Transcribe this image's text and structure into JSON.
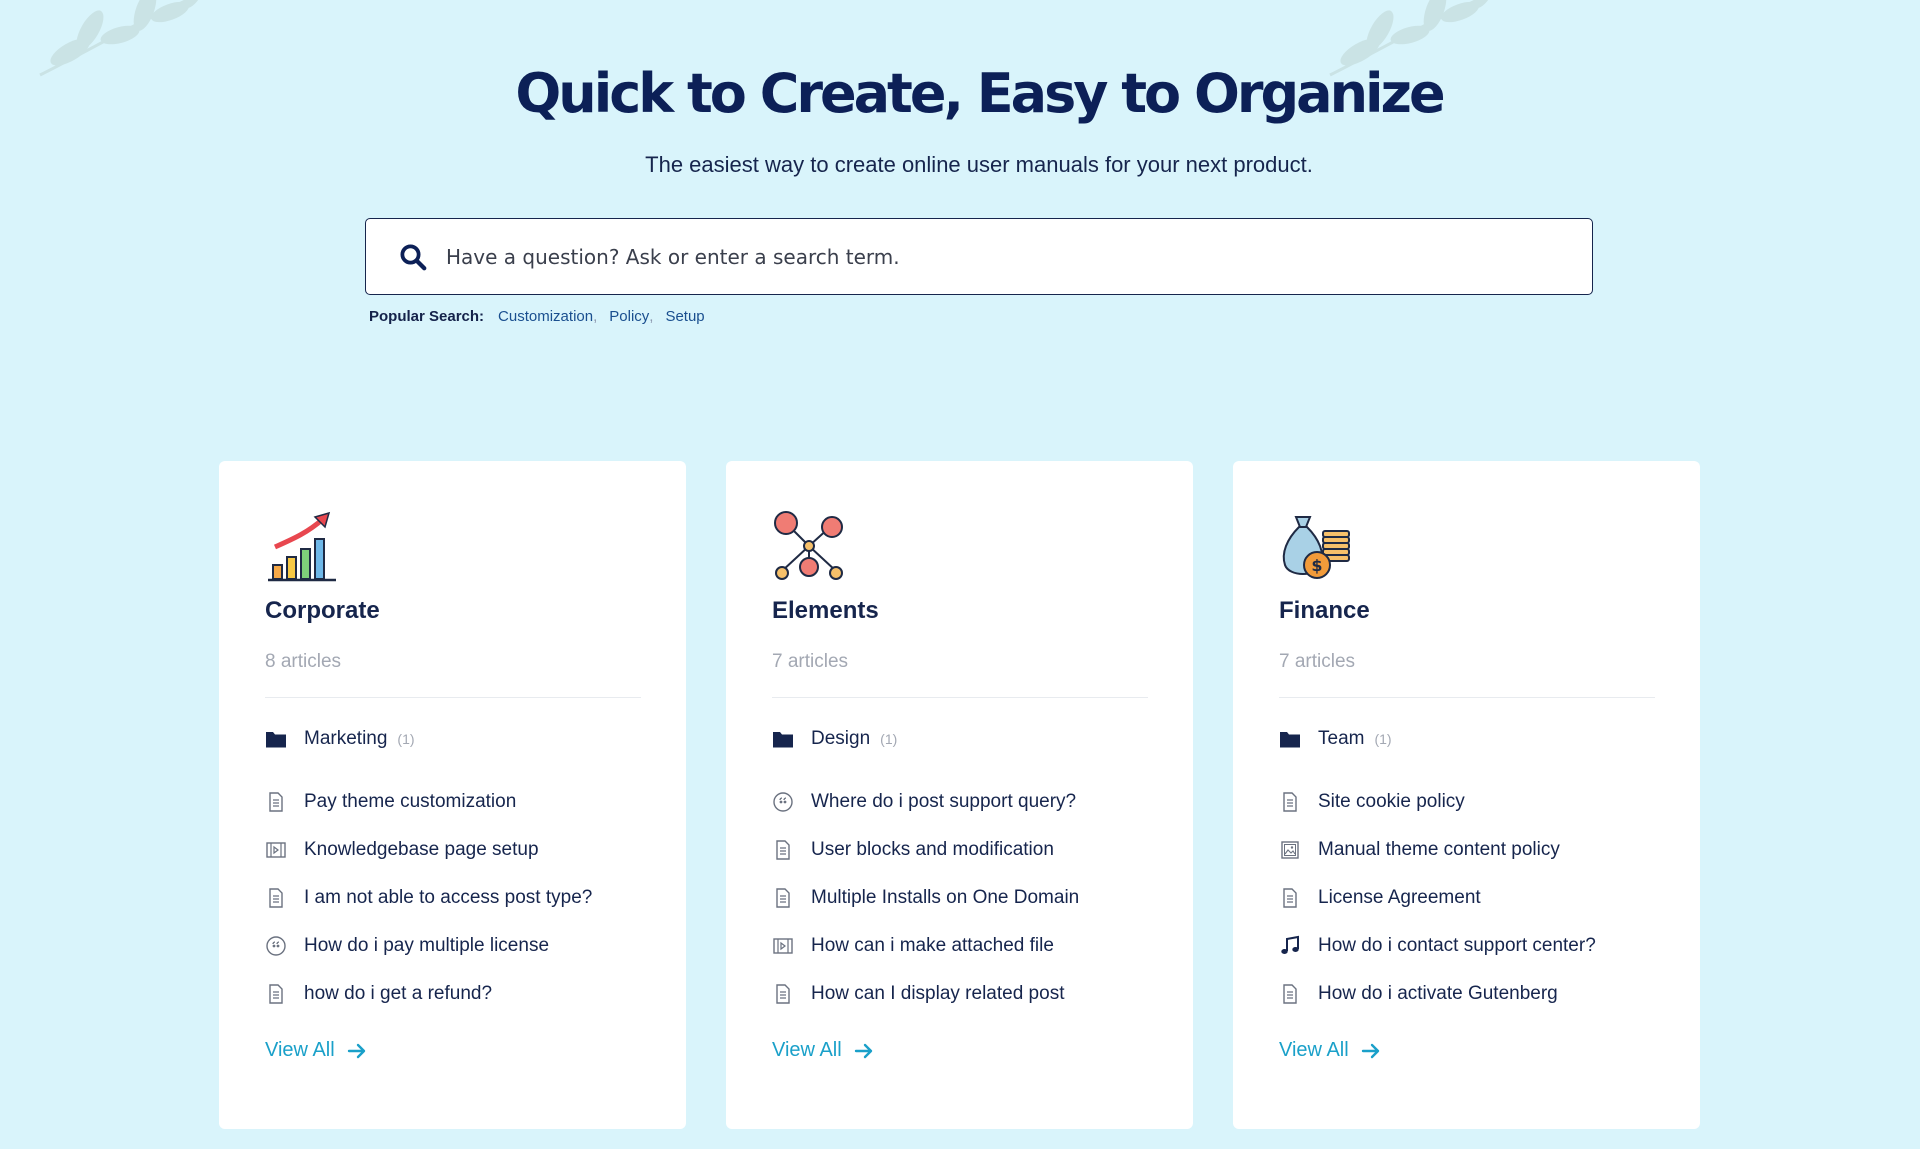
{
  "hero": {
    "title": "Quick to Create, Easy to Organize",
    "subtitle": "The easiest way to create online user manuals for your next product."
  },
  "search": {
    "placeholder": "Have a question? Ask or enter a search term.",
    "icon": "search-icon"
  },
  "popular": {
    "label": "Popular Search:",
    "links": [
      "Customization",
      "Policy",
      "Setup"
    ]
  },
  "colors": {
    "background": "#d9f4fb",
    "heading": "#0c2057",
    "link": "#1aa0c9",
    "muted": "#a3a8b3"
  },
  "cards": [
    {
      "icon": "growth-chart-icon",
      "title": "Corporate",
      "count": "8 articles",
      "folder": {
        "label": "Marketing",
        "count": "(1)"
      },
      "articles": [
        {
          "icon": "document-icon",
          "label": "Pay theme customization"
        },
        {
          "icon": "video-icon",
          "label": "Knowledgebase page setup"
        },
        {
          "icon": "document-icon",
          "label": "I am not able to access post type?"
        },
        {
          "icon": "quote-icon",
          "label": "How do i pay multiple license"
        },
        {
          "icon": "document-icon",
          "label": "how do i get a refund?"
        }
      ],
      "view_all": "View All"
    },
    {
      "icon": "network-nodes-icon",
      "title": "Elements",
      "count": "7 articles",
      "folder": {
        "label": "Design",
        "count": "(1)"
      },
      "articles": [
        {
          "icon": "quote-icon",
          "label": "Where do i post support query?"
        },
        {
          "icon": "document-icon",
          "label": "User blocks and modification"
        },
        {
          "icon": "document-icon",
          "label": "Multiple Installs on One Domain"
        },
        {
          "icon": "video-icon",
          "label": "How can i make attached file"
        },
        {
          "icon": "document-icon",
          "label": "How can I display related post"
        }
      ],
      "view_all": "View All"
    },
    {
      "icon": "money-bag-icon",
      "title": "Finance",
      "count": "7 articles",
      "folder": {
        "label": "Team",
        "count": "(1)"
      },
      "articles": [
        {
          "icon": "document-icon",
          "label": "Site cookie policy"
        },
        {
          "icon": "image-icon",
          "label": "Manual theme content policy"
        },
        {
          "icon": "document-icon",
          "label": "License Agreement"
        },
        {
          "icon": "music-icon",
          "label": "How do i contact support center?"
        },
        {
          "icon": "document-icon",
          "label": "How do i activate Gutenberg"
        }
      ],
      "view_all": "View All"
    }
  ]
}
